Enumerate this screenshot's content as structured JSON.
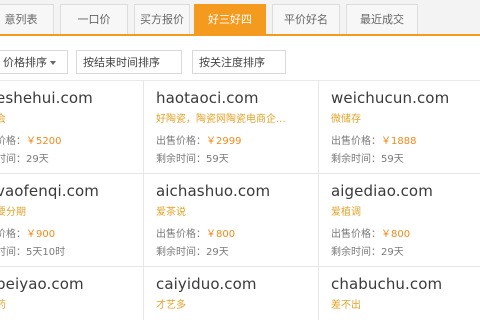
{
  "tabs": [
    {
      "label": "意列表"
    },
    {
      "label": "一口价"
    },
    {
      "label": "买方报价"
    },
    {
      "label": "好三好四"
    },
    {
      "label": "平价好名"
    },
    {
      "label": "最近成交"
    }
  ],
  "sort": [
    {
      "label": "价格排序"
    },
    {
      "label": "按结束时间排序"
    },
    {
      "label": "按关注度排序"
    }
  ],
  "cards": [
    {
      "domain": "eshehui.com",
      "tag": "会",
      "price_label": "价格：",
      "price": "￥5200",
      "time_label": "时间：",
      "time": "29天"
    },
    {
      "domain": "haotaoci.com",
      "tag": "好陶瓷，陶瓷网陶瓷电商企...",
      "price_label": "出售价格：",
      "price": "￥2999",
      "time_label": "剩余时间：",
      "time": "59天"
    },
    {
      "domain": "weichucun.com",
      "tag": "微储存",
      "price_label": "出售价格：",
      "price": "￥1888",
      "time_label": "剩余时间：",
      "time": "59天"
    },
    {
      "domain": "vaofenqi.com",
      "tag": "要分期",
      "price_label": "价格：",
      "price": "￥900",
      "time_label": "时间：",
      "time": "5天10时"
    },
    {
      "domain": "aichashuo.com",
      "tag": "爱茶说",
      "price_label": "出售价格：",
      "price": "￥800",
      "time_label": "剩余时间：",
      "time": "29天"
    },
    {
      "domain": "aigediao.com",
      "tag": "爱植调",
      "price_label": "出售价格：",
      "price": "￥800",
      "time_label": "剩余时间：",
      "time": "29天"
    },
    {
      "domain": "peiyao.com",
      "tag": "药",
      "price_label": "",
      "price": "",
      "time_label": "",
      "time": ""
    },
    {
      "domain": "caiyiduo.com",
      "tag": "才艺多",
      "price_label": "",
      "price": "",
      "time_label": "",
      "time": ""
    },
    {
      "domain": "chabuchu.com",
      "tag": "差不出",
      "price_label": "",
      "price": "",
      "time_label": "",
      "time": ""
    }
  ],
  "colors": {
    "accent": "#f39a1f",
    "price": "#f08a1a",
    "tag": "#e2a32a"
  }
}
